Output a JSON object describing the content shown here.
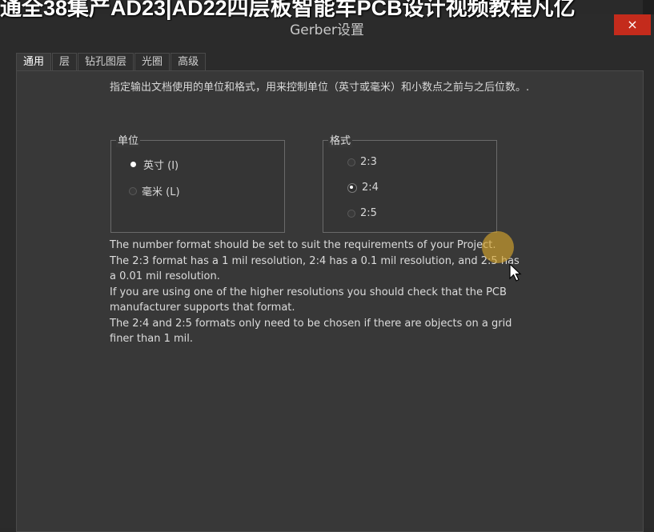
{
  "overlay_banner": "通全38集产AD23|AD22四层板智能车PCB设计视频教程凡亿",
  "window": {
    "title": "Gerber设置",
    "close_label": "×"
  },
  "tabs": [
    {
      "label": "通用",
      "active": true
    },
    {
      "label": "层"
    },
    {
      "label": "钻孔图层"
    },
    {
      "label": "光圈"
    },
    {
      "label": "高级"
    }
  ],
  "description": "指定输出文档使用的单位和格式，用来控制单位（英寸或毫米）和小数点之前与之后位数。.",
  "units": {
    "title": "单位",
    "options": [
      {
        "label": "英寸 (I)",
        "selected": true
      },
      {
        "label": "毫米 (L)",
        "selected": false
      }
    ]
  },
  "format": {
    "title": "格式",
    "options": [
      {
        "label": "2:3",
        "selected": false
      },
      {
        "label": "2:4",
        "selected": true
      },
      {
        "label": "2:5",
        "selected": false
      }
    ]
  },
  "info_lines": [
    "The number format should be set to suit the requirements of your Project.",
    "The 2:3 format has a 1 mil resolution, 2:4 has a 0.1 mil resolution, and 2:5 has a 0.01 mil resolution.",
    "If you are using one of the higher resolutions you should check that the PCB manufacturer supports that format.",
    "The 2:4 and 2:5 formats only need to be chosen if there are objects on a grid finer than 1 mil."
  ],
  "colors": {
    "close": "#c42b1c",
    "cursor_highlight": "#d6a42c"
  },
  "cursor": {
    "icon": "mouse-pointer-icon"
  }
}
